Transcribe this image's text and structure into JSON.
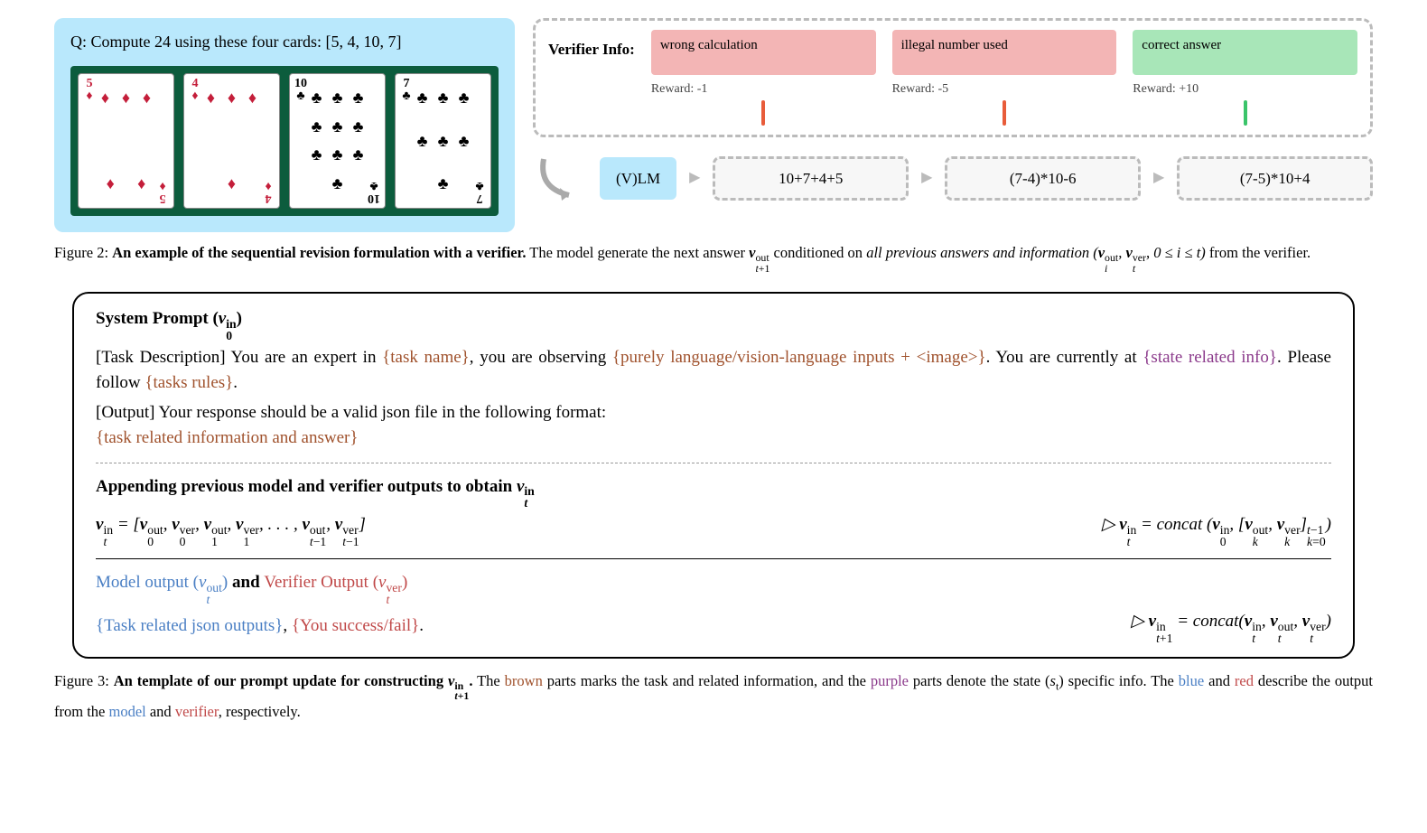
{
  "fig2": {
    "question": "Q: Compute 24 using these four cards: [5, 4, 10, 7]",
    "cards": [
      {
        "rank": "5",
        "suit": "diamond",
        "color": "red"
      },
      {
        "rank": "4",
        "suit": "diamond",
        "color": "red"
      },
      {
        "rank": "10",
        "suit": "club",
        "color": "black"
      },
      {
        "rank": "7",
        "suit": "club",
        "color": "black"
      }
    ],
    "verifier_label": "Verifier Info:",
    "verifiers": [
      {
        "text": "wrong calculation",
        "type": "red",
        "reward": "Reward: -1",
        "expr": "10+7+4+5",
        "conn": "cred"
      },
      {
        "text": "illegal number used",
        "type": "red",
        "reward": "Reward: -5",
        "expr": "(7-4)*10-6",
        "conn": "cred"
      },
      {
        "text": "correct answer",
        "type": "green",
        "reward": "Reward: +10",
        "expr": "(7-5)*10+4",
        "conn": "cgreen"
      }
    ],
    "vlm": "(V)LM",
    "caption_lead": "Figure 2: ",
    "caption_bold": "An example of the sequential revision formulation with a verifier.",
    "caption_rest1": " The model generate the next answer ",
    "caption_rest2": " conditioned on ",
    "caption_ital": "all previous answers and information",
    "caption_rest3": " from the verifier."
  },
  "fig3": {
    "sp_title": "System Prompt (",
    "task_desc_label": "[Task Description] You are an expert in ",
    "tn": "{task name}",
    "obs": ", you are observing ",
    "inputs": "{purely language/vision-language inputs + <image>}",
    "curr": ".  You are currently at ",
    "state": "{state related info}",
    "follow": ".  Please follow ",
    "rules": "{tasks rules}",
    "period": ".",
    "output_label": "[Output] Your response should be a valid json file in the following format:",
    "task_info": "{task related information and answer}",
    "append_title": "Appending previous model and verifier outputs to obtain ",
    "model_out": "Model output (",
    "and": " and ",
    "ver_out": "Verifier Output (",
    "task_json": "{Task related json outputs}",
    "comma": ", ",
    "succfail": "{You success/fail}",
    "caption_lead": "Figure 3: ",
    "caption_bold": "An template of our prompt update for constructing ",
    "caption_rest1": " The ",
    "caption_brown": "brown",
    "caption_rest2": " parts marks the task and related information, and the ",
    "caption_purple": "purple",
    "caption_rest3": " parts denote the state (",
    "caption_rest4": ") specific info. The ",
    "caption_blue": "blue",
    "caption_rest5": " and ",
    "caption_red": "red",
    "caption_rest6": " describe the output from the ",
    "caption_model": "model",
    "caption_rest7": " and ",
    "caption_verifier": "verifier",
    "caption_rest8": ", respectively."
  }
}
